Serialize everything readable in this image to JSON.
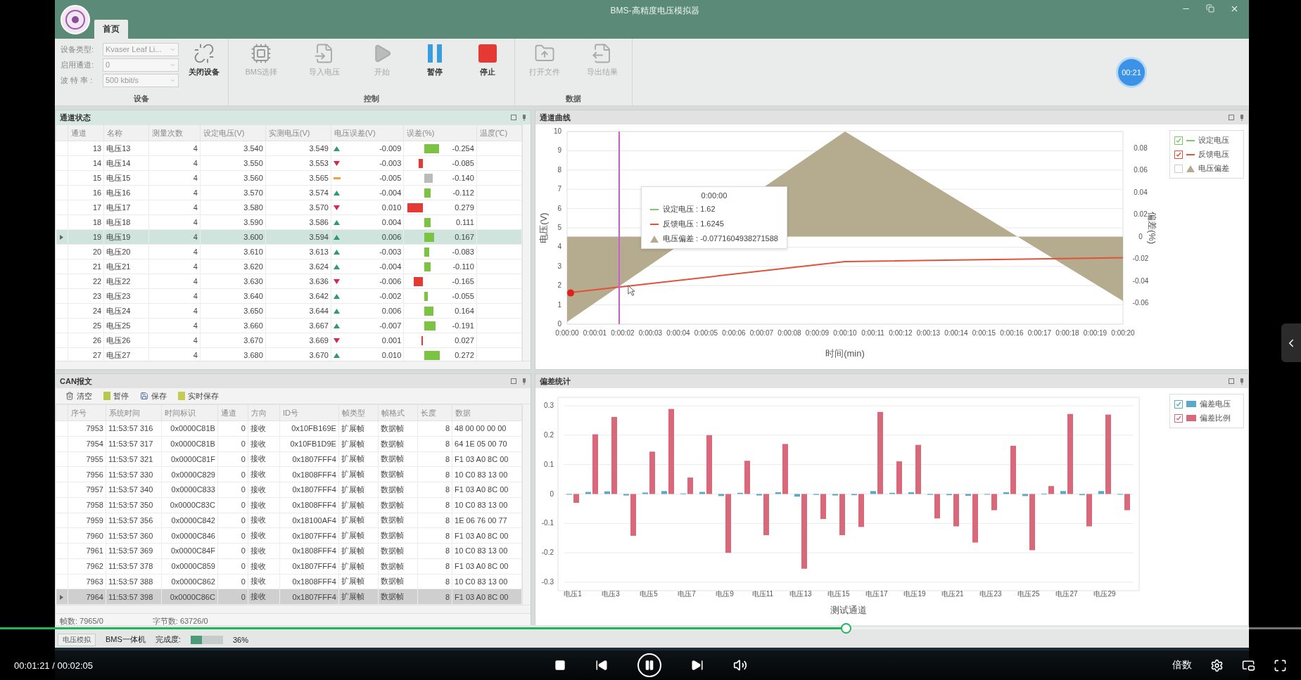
{
  "app": {
    "title_bar": {
      "title": "BMS-高精度电压模拟器",
      "tabs": [
        {
          "label": "首页",
          "selected": true
        }
      ]
    },
    "ribbon": {
      "fields": [
        {
          "label": "设备类型:",
          "value": "Kvaser Leaf Li..."
        },
        {
          "label": "启用通道:",
          "value": "0"
        },
        {
          "label": "波 特 率 :",
          "value": "500 kbit/s"
        }
      ],
      "groups": [
        {
          "label": "设备",
          "buttons": [
            {
              "label": "关闭设备",
              "kind": "unlink",
              "disabled": false
            }
          ]
        },
        {
          "label": "控制",
          "buttons": [
            {
              "label": "BMS选择",
              "kind": "chip",
              "disabled": true
            },
            {
              "label": "导入电压",
              "kind": "import",
              "disabled": true
            },
            {
              "label": "开始",
              "kind": "play",
              "disabled": true
            },
            {
              "label": "暂停",
              "kind": "pause",
              "disabled": false
            },
            {
              "label": "停止",
              "kind": "stop",
              "disabled": false
            }
          ]
        },
        {
          "label": "数据",
          "buttons": [
            {
              "label": "打开文件",
              "kind": "open",
              "disabled": true
            },
            {
              "label": "导出结果",
              "kind": "export",
              "disabled": true
            }
          ]
        }
      ],
      "timer": "00:21"
    },
    "channel_panel": {
      "title": "通道状态",
      "columns": [
        "通道",
        "名称",
        "测量次数",
        "设定电压(V)",
        "实测电压(V)",
        "电压误差(V)",
        "误差(%)",
        "温度(℃)"
      ],
      "rows": [
        {
          "cells": [
            "13",
            "电压13",
            "4",
            "3.540",
            "3.549"
          ],
          "kind": "up",
          "error_v": "-0.009",
          "error_pct": "-0.254",
          "selected": false
        },
        {
          "cells": [
            "14",
            "电压14",
            "4",
            "3.550",
            "3.553"
          ],
          "kind": "down",
          "error_v": "-0.003",
          "error_pct": "-0.085",
          "selected": false
        },
        {
          "cells": [
            "15",
            "电压15",
            "4",
            "3.560",
            "3.565"
          ],
          "kind": "flat",
          "error_v": "-0.005",
          "error_pct": "-0.140",
          "selected": false
        },
        {
          "cells": [
            "16",
            "电压16",
            "4",
            "3.570",
            "3.574"
          ],
          "kind": "up",
          "error_v": "-0.004",
          "error_pct": "-0.112",
          "selected": false
        },
        {
          "cells": [
            "17",
            "电压17",
            "4",
            "3.580",
            "3.570"
          ],
          "kind": "down",
          "error_v": "0.010",
          "error_pct": "0.279",
          "selected": false
        },
        {
          "cells": [
            "18",
            "电压18",
            "4",
            "3.590",
            "3.586"
          ],
          "kind": "up",
          "error_v": "0.004",
          "error_pct": "0.111",
          "selected": false
        },
        {
          "cells": [
            "19",
            "电压19",
            "4",
            "3.600",
            "3.594"
          ],
          "kind": "up",
          "error_v": "0.006",
          "error_pct": "0.167",
          "selected": true
        },
        {
          "cells": [
            "20",
            "电压20",
            "4",
            "3.610",
            "3.613"
          ],
          "kind": "up",
          "error_v": "-0.003",
          "error_pct": "-0.083",
          "selected": false
        },
        {
          "cells": [
            "21",
            "电压21",
            "4",
            "3.620",
            "3.624"
          ],
          "kind": "up",
          "error_v": "-0.004",
          "error_pct": "-0.110",
          "selected": false
        },
        {
          "cells": [
            "22",
            "电压22",
            "4",
            "3.630",
            "3.636"
          ],
          "kind": "down",
          "error_v": "-0.006",
          "error_pct": "-0.165",
          "selected": false
        },
        {
          "cells": [
            "23",
            "电压23",
            "4",
            "3.640",
            "3.642"
          ],
          "kind": "up",
          "error_v": "-0.002",
          "error_pct": "-0.055",
          "selected": false
        },
        {
          "cells": [
            "24",
            "电压24",
            "4",
            "3.650",
            "3.644"
          ],
          "kind": "up",
          "error_v": "0.006",
          "error_pct": "0.164",
          "selected": false
        },
        {
          "cells": [
            "25",
            "电压25",
            "4",
            "3.660",
            "3.667"
          ],
          "kind": "up",
          "error_v": "-0.007",
          "error_pct": "-0.191",
          "selected": false
        },
        {
          "cells": [
            "26",
            "电压26",
            "4",
            "3.670",
            "3.669"
          ],
          "kind": "down",
          "error_v": "0.001",
          "error_pct": "0.027",
          "selected": false
        },
        {
          "cells": [
            "27",
            "电压27",
            "4",
            "3.680",
            "3.670"
          ],
          "kind": "up",
          "error_v": "0.010",
          "error_pct": "0.272",
          "selected": false
        }
      ]
    },
    "curve_panel": {
      "title": "通道曲线",
      "chart_data": {
        "type": "line",
        "xlabel": "时间(min)",
        "ylabel": "电压(V)",
        "y2label": "偏差(%)",
        "x": [
          0,
          10,
          20
        ],
        "xlim": [
          0,
          20
        ],
        "ylim": [
          0,
          10
        ],
        "y2lim": [
          -0.079,
          0.095
        ],
        "yticks": [
          0,
          1,
          2,
          3,
          4,
          5,
          6,
          7,
          8,
          9,
          10
        ],
        "y2ticks": [
          {
            "value": -0.06,
            "label": "-0.06"
          },
          {
            "value": -0.04,
            "label": "-0.04"
          },
          {
            "value": -0.02,
            "label": "-0.02"
          },
          {
            "value": 0,
            "label": "0"
          },
          {
            "value": 0.02,
            "label": "0.02"
          },
          {
            "value": 0.04,
            "label": "0.04"
          },
          {
            "value": 0.06,
            "label": "0.06"
          },
          {
            "value": 0.08,
            "label": "0.08"
          }
        ],
        "xticks": [
          {
            "value": 0,
            "label": "0:00:00"
          },
          {
            "value": 1,
            "label": "0:00:01"
          },
          {
            "value": 2,
            "label": "0:00:02"
          },
          {
            "value": 3,
            "label": "0:00:03"
          },
          {
            "value": 4,
            "label": "0:00:04"
          },
          {
            "value": 5,
            "label": "0:00:05"
          },
          {
            "value": 6,
            "label": "0:00:06"
          },
          {
            "value": 7,
            "label": "0:00:07"
          },
          {
            "value": 8,
            "label": "0:00:08"
          },
          {
            "value": 9,
            "label": "0:00:09"
          },
          {
            "value": 10,
            "label": "0:00:10"
          },
          {
            "value": 11,
            "label": "0:00:11"
          },
          {
            "value": 12,
            "label": "0:00:12"
          },
          {
            "value": 13,
            "label": "0:00:13"
          },
          {
            "value": 14,
            "label": "0:00:14"
          },
          {
            "value": 15,
            "label": "0:00:15"
          },
          {
            "value": 16,
            "label": "0:00:16"
          },
          {
            "value": 17,
            "label": "0:00:17"
          },
          {
            "value": 18,
            "label": "0:00:18"
          },
          {
            "value": 19,
            "label": "0:00:19"
          },
          {
            "value": 20,
            "label": "0:00:20"
          }
        ],
        "series": [
          {
            "name": "设定电压",
            "color": "#7ac96b",
            "values": [
              null,
              null,
              null
            ]
          },
          {
            "name": "反馈电压",
            "color": "#e0523a",
            "values": [
              1.62,
              3.25,
              3.45
            ]
          },
          {
            "name": "电压偏差",
            "color": "#b5ab8e",
            "type": "area",
            "axis": "y2",
            "values": [
              -0.077,
              0.095,
              -0.058
            ]
          }
        ],
        "grid": true
      },
      "legend": [
        {
          "checked": true
        },
        {
          "checked": true
        },
        {
          "checked": false
        }
      ],
      "tooltip": {
        "title": "0:00:00",
        "entries": [
          {
            "label": "设定电压 : 1.62",
            "kind": "line",
            "color": "#7ac96b"
          },
          {
            "label": "反馈电压 : 1.6245",
            "kind": "line",
            "color": "#e0523a"
          },
          {
            "label": "电压偏差 : -0.0771604938271588",
            "kind": "area",
            "color": "#b5ab8e"
          }
        ]
      }
    },
    "can_panel": {
      "title": "CAN报文",
      "tools": [
        {
          "label": "清空",
          "kind": "trash"
        },
        {
          "label": "暂停",
          "kind": "pause"
        },
        {
          "label": "保存",
          "kind": "save"
        },
        {
          "label": "实时保存",
          "kind": "live"
        }
      ],
      "columns": [
        "序号",
        "系统时间",
        "时间标识",
        "通道",
        "方向",
        "ID号",
        "帧类型",
        "帧格式",
        "长度",
        "数据"
      ],
      "rows": [
        {
          "cells": [
            "7953",
            "11:53:57 316",
            "0x0000C81B",
            "0",
            "接收",
            "0x10FB169E",
            "扩展帧",
            "数据帧",
            "8",
            "48 00 00 00 00"
          ],
          "selected": false
        },
        {
          "cells": [
            "7954",
            "11:53:57 317",
            "0x0000C81B",
            "0",
            "接收",
            "0x10FB1D9E",
            "扩展帧",
            "数据帧",
            "8",
            "64 1E 05 00 70"
          ],
          "selected": false
        },
        {
          "cells": [
            "7955",
            "11:53:57 321",
            "0x0000C81F",
            "0",
            "接收",
            "0x1807FFF4",
            "扩展帧",
            "数据帧",
            "8",
            "F1 03 A0 8C 00"
          ],
          "selected": false
        },
        {
          "cells": [
            "7956",
            "11:53:57 330",
            "0x0000C829",
            "0",
            "接收",
            "0x1808FFF4",
            "扩展帧",
            "数据帧",
            "8",
            "10 C0 83 13 00"
          ],
          "selected": false
        },
        {
          "cells": [
            "7957",
            "11:53:57 340",
            "0x0000C833",
            "0",
            "接收",
            "0x1807FFF4",
            "扩展帧",
            "数据帧",
            "8",
            "F1 03 A0 8C 00"
          ],
          "selected": false
        },
        {
          "cells": [
            "7958",
            "11:53:57 350",
            "0x0000C83C",
            "0",
            "接收",
            "0x1808FFF4",
            "扩展帧",
            "数据帧",
            "8",
            "10 C0 83 13 00"
          ],
          "selected": false
        },
        {
          "cells": [
            "7959",
            "11:53:57 356",
            "0x0000C842",
            "0",
            "接收",
            "0x18100AF4",
            "扩展帧",
            "数据帧",
            "8",
            "1E 06 76 00 77"
          ],
          "selected": false
        },
        {
          "cells": [
            "7960",
            "11:53:57 360",
            "0x0000C846",
            "0",
            "接收",
            "0x1807FFF4",
            "扩展帧",
            "数据帧",
            "8",
            "F1 03 A0 8C 00"
          ],
          "selected": false
        },
        {
          "cells": [
            "7961",
            "11:53:57 369",
            "0x0000C84F",
            "0",
            "接收",
            "0x1808FFF4",
            "扩展帧",
            "数据帧",
            "8",
            "10 C0 83 13 00"
          ],
          "selected": false
        },
        {
          "cells": [
            "7962",
            "11:53:57 378",
            "0x0000C859",
            "0",
            "接收",
            "0x1807FFF4",
            "扩展帧",
            "数据帧",
            "8",
            "F1 03 A0 8C 00"
          ],
          "selected": false
        },
        {
          "cells": [
            "7963",
            "11:53:57 388",
            "0x0000C862",
            "0",
            "接收",
            "0x1808FFF4",
            "扩展帧",
            "数据帧",
            "8",
            "10 C0 83 13 00"
          ],
          "selected": false
        },
        {
          "cells": [
            "7964",
            "11:53:57 398",
            "0x0000C86C",
            "0",
            "接收",
            "0x1807FFF4",
            "扩展帧",
            "数据帧",
            "8",
            "F1 03 A0 8C 00"
          ],
          "selected": true
        }
      ],
      "footer": [
        "帧数: 7965/0",
        "字节数: 63726/0"
      ]
    },
    "stats_panel": {
      "title": "偏差统计",
      "chart_data": {
        "type": "bar",
        "xlabel": "测试通道",
        "grid": true,
        "categories": [
          "电压1",
          null,
          "电压3",
          null,
          "电压5",
          null,
          "电压7",
          null,
          "电压9",
          null,
          "电压11",
          null,
          "电压13",
          null,
          "电压15",
          null,
          "电压17",
          null,
          "电压19",
          null,
          "电压21",
          null,
          "电压23",
          null,
          "电压25",
          null,
          "电压27",
          null,
          "电压29",
          null
        ],
        "ylim": [
          -0.3,
          0.3
        ],
        "yticks": [
          {
            "value": -0.3,
            "label": "-0.3"
          },
          {
            "value": -0.2,
            "label": "-0.2"
          },
          {
            "value": -0.1,
            "label": "-0.1"
          },
          {
            "value": 0,
            "label": "0"
          },
          {
            "value": 0.1,
            "label": "0.1"
          },
          {
            "value": 0.2,
            "label": "0.2"
          },
          {
            "value": 0.3,
            "label": "0.3"
          }
        ],
        "series": [
          {
            "name": "偏差电压",
            "color": "#5aa9c9",
            "values": [
              -0.001,
              0.007,
              0.009,
              -0.005,
              0.005,
              0.01,
              0.002,
              0.007,
              -0.007,
              0.004,
              -0.005,
              0.006,
              -0.009,
              -0.003,
              -0.005,
              -0.004,
              0.01,
              0.004,
              0.006,
              -0.003,
              -0.004,
              -0.006,
              -0.002,
              0.006,
              -0.007,
              0.001,
              0.01,
              -0.004,
              0.01,
              -0.002
            ]
          },
          {
            "name": "偏差比例",
            "color": "#d9687a",
            "values": [
              -0.03,
              0.203,
              0.262,
              -0.142,
              0.144,
              0.289,
              0.056,
              0.2,
              -0.2,
              0.113,
              -0.14,
              0.17,
              -0.254,
              -0.085,
              -0.14,
              -0.112,
              0.279,
              0.111,
              0.167,
              -0.083,
              -0.11,
              -0.165,
              -0.055,
              0.164,
              -0.191,
              0.027,
              0.272,
              -0.11,
              0.27,
              -0.055
            ]
          }
        ]
      },
      "legend": [
        {
          "checked": true
        },
        {
          "checked": true
        }
      ]
    },
    "status_bar": {
      "tab": "电压模拟",
      "device": "BMS一体机",
      "progress_label": "完成度:",
      "level": 0.36,
      "reading": "36%"
    }
  },
  "player": {
    "time": "00:01:21 / 00:02:05",
    "level": 0.65,
    "playing": true,
    "speed": "倍数"
  }
}
